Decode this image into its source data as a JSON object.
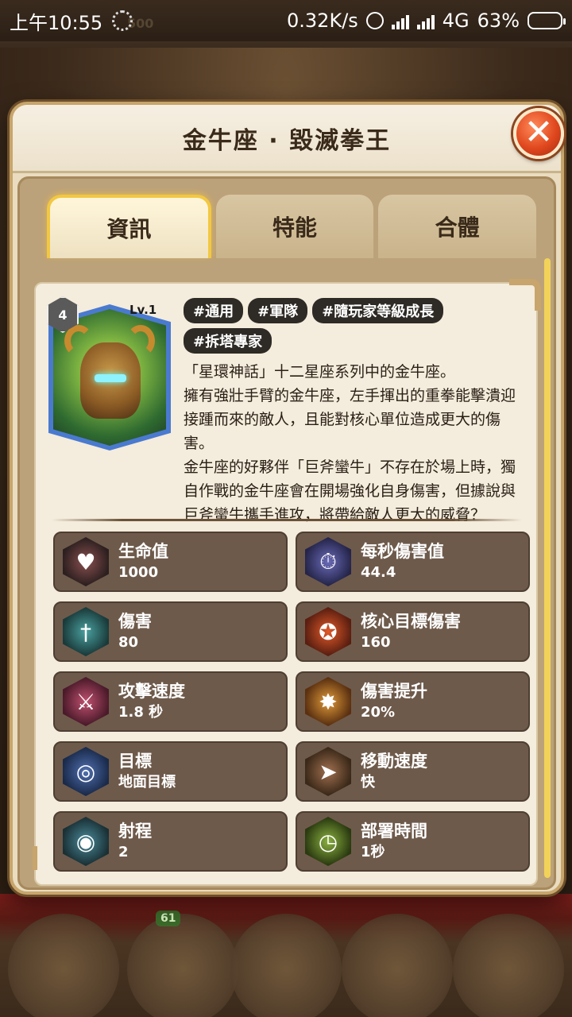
{
  "status_bar": {
    "time": "上午10:55",
    "network_speed": "0.32K/s",
    "network_type": "4G",
    "battery": "63%",
    "battery_level": 0.63
  },
  "background": {
    "currency": "500",
    "badge_count": "61"
  },
  "dialog": {
    "title": "金牛座 · 毀滅拳王",
    "close_label": "✕"
  },
  "tabs": [
    {
      "label": "資訊",
      "active": true
    },
    {
      "label": "特能",
      "active": false
    },
    {
      "label": "合體",
      "active": false
    }
  ],
  "card": {
    "cost": "4",
    "level": "Lv.1"
  },
  "tags": [
    "#通用",
    "#軍隊",
    "#隨玩家等級成長",
    "#拆塔專家"
  ],
  "description": [
    "「星環神話」十二星座系列中的金牛座。",
    "擁有強壯手臂的金牛座，左手揮出的重拳能擊潰迎接踵而來的敵人，且能對核心單位造成更大的傷害。",
    "金牛座的好夥伴「巨斧蠻牛」不存在於場上時，獨自作戰的金牛座會在開場強化自身傷害，但據說與巨斧蠻牛攜手進攻，將帶給敵人更大的威脅？"
  ],
  "stats": [
    {
      "label": "生命值",
      "value": "1000",
      "icon": "heart-icon"
    },
    {
      "label": "每秒傷害值",
      "value": "44.4",
      "icon": "clock-sword-icon"
    },
    {
      "label": "傷害",
      "value": "80",
      "icon": "sword-icon"
    },
    {
      "label": "核心目標傷害",
      "value": "160",
      "icon": "core-target-icon"
    },
    {
      "label": "攻擊速度",
      "value": "1.8 秒",
      "icon": "attack-speed-icon"
    },
    {
      "label": "傷害提升",
      "value": "20%",
      "icon": "damage-boost-icon"
    },
    {
      "label": "目標",
      "value": "地面目標",
      "icon": "crosshair-icon"
    },
    {
      "label": "移動速度",
      "value": "快",
      "icon": "boot-icon"
    },
    {
      "label": "射程",
      "value": "2",
      "icon": "bullseye-icon"
    },
    {
      "label": "部署時間",
      "value": "1秒",
      "icon": "stopwatch-icon"
    }
  ]
}
